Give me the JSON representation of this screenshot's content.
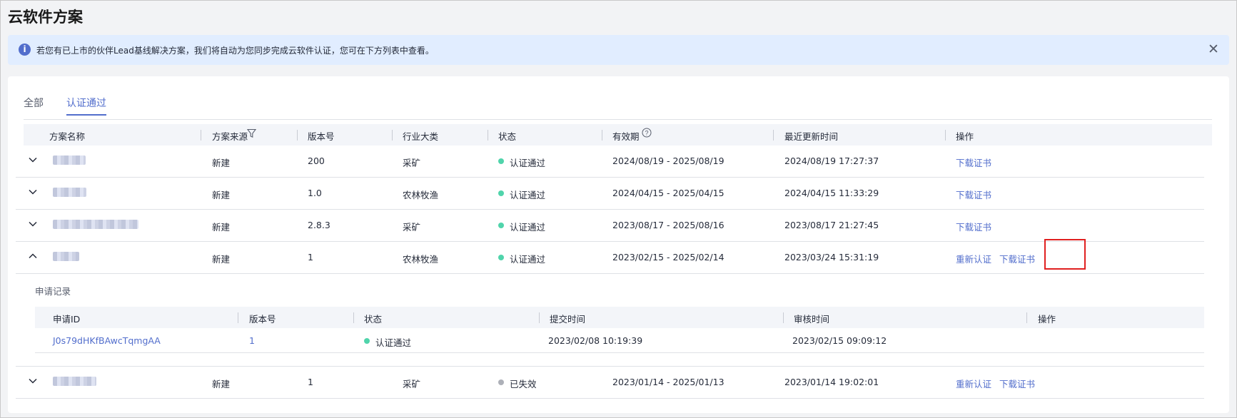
{
  "page": {
    "title": "云软件方案"
  },
  "notice": {
    "text": "若您有已上市的伙伴Lead基线解决方案，我们将自动为您同步完成云软件认证，您可在下方列表中查看。",
    "info_icon": "info-icon",
    "close_icon": "close-icon"
  },
  "tabs": [
    {
      "label": "全部"
    },
    {
      "label": "认证通过",
      "active": true
    }
  ],
  "table": {
    "headers": {
      "name": "方案名称",
      "source": "方案来源",
      "version": "版本号",
      "industry": "行业大类",
      "status": "状态",
      "validity": "有效期",
      "updated": "最近更新时间",
      "action": "操作"
    },
    "rows": [
      {
        "source": "新建",
        "version": "200",
        "industry": "采矿",
        "status": "认证通过",
        "validity": "2024/08/19 - 2025/08/19",
        "updated": "2024/08/19 17:27:37",
        "action": "下载证书"
      },
      {
        "source": "新建",
        "version": "1.0",
        "industry": "农林牧渔",
        "status": "认证通过",
        "validity": "2024/04/15 - 2025/04/15",
        "updated": "2024/04/15 11:33:29",
        "action": "下载证书"
      },
      {
        "source": "新建",
        "version": "2.8.3",
        "industry": "采矿",
        "status": "认证通过",
        "validity": "2023/08/17 - 2025/08/16",
        "updated": "2023/08/17 21:27:45",
        "action": "下载证书"
      },
      {
        "source": "新建",
        "version": "1",
        "industry": "农林牧渔",
        "status": "认证通过",
        "validity": "2023/02/15 - 2025/02/14",
        "updated": "2023/03/24 15:31:19",
        "action": "重新认证",
        "action2": "下载证书",
        "expanded": true
      },
      {
        "source": "新建",
        "version": "1",
        "industry": "采矿",
        "status": "已失效",
        "validity": "2023/01/14 - 2025/01/13",
        "updated": "2023/01/14 19:02:01",
        "action": "重新认证",
        "action2": "下载证书"
      }
    ]
  },
  "records": {
    "title": "申请记录",
    "headers": {
      "id": "申请ID",
      "version": "版本号",
      "status": "状态",
      "submitted": "提交时间",
      "reviewed": "审核时间",
      "action": "操作"
    },
    "rows": [
      {
        "id": "J0s79dHKfBAwcTqmgAA",
        "version": "1",
        "status": "认证通过",
        "submitted": "2023/02/08 10:19:39",
        "reviewed": "2023/02/15 09:09:12"
      }
    ]
  },
  "colors": {
    "accent": "#526ecc",
    "status_ok": "#50d4ab",
    "status_expired": "#adb0b8",
    "highlight": "#e02020"
  }
}
